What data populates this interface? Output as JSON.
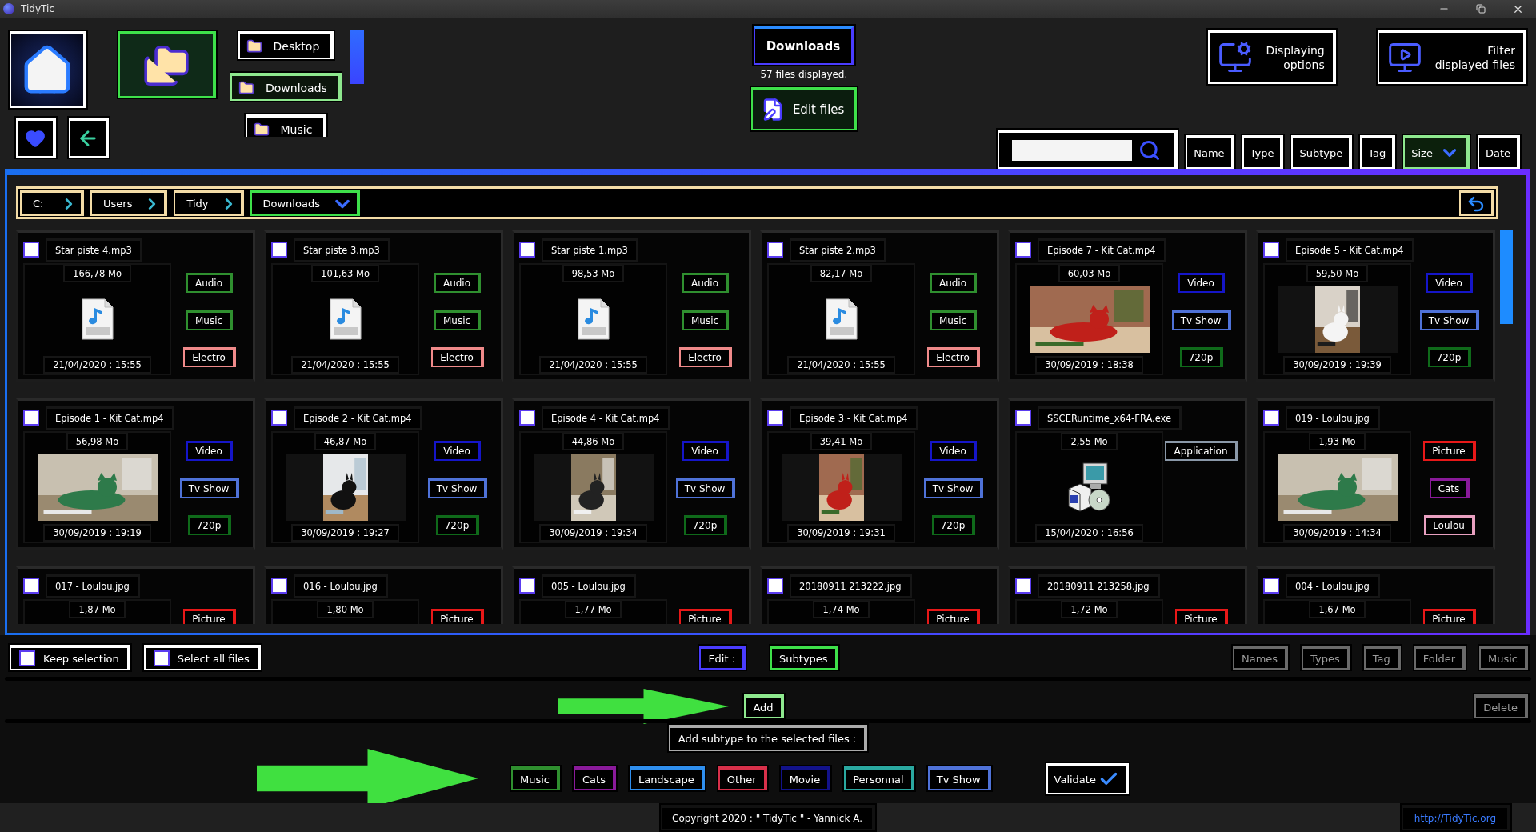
{
  "window": {
    "title": "TidyTic"
  },
  "nav": {
    "folders": [
      {
        "label": "Desktop",
        "selected": false
      },
      {
        "label": "Downloads",
        "selected": true
      },
      {
        "label": "Music",
        "selected": false
      }
    ]
  },
  "current": {
    "title": "Downloads",
    "count": "57 files displayed.",
    "edit_button": "Edit files"
  },
  "options": [
    {
      "kind": "display",
      "lines": [
        "Displaying",
        "options"
      ]
    },
    {
      "kind": "filter",
      "lines": [
        "Filter",
        "displayed files"
      ]
    }
  ],
  "sort_buttons": [
    {
      "label": "Name",
      "selected": false
    },
    {
      "label": "Type",
      "selected": false
    },
    {
      "label": "Subtype",
      "selected": false
    },
    {
      "label": "Tag",
      "selected": false
    },
    {
      "label": "Size",
      "selected": true
    },
    {
      "label": "Date",
      "selected": false
    }
  ],
  "breadcrumb": [
    {
      "label": "C:",
      "selected": false
    },
    {
      "label": "Users",
      "selected": false
    },
    {
      "label": "Tidy",
      "selected": false
    },
    {
      "label": "Downloads",
      "selected": true
    }
  ],
  "files": [
    {
      "name": "Star piste 4.mp3",
      "checked": false,
      "size": "166,78 Mo",
      "date": "21/04/2020 : 15:55",
      "kind": "audio",
      "tags": [
        {
          "label": "Audio",
          "color": "#2f8f2f"
        },
        {
          "label": "Music",
          "color": "#2f8f2f"
        },
        {
          "label": "Electro",
          "color": "#f08a8a"
        }
      ]
    },
    {
      "name": "Star piste 3.mp3",
      "checked": false,
      "size": "101,63 Mo",
      "date": "21/04/2020 : 15:55",
      "kind": "audio",
      "tags": [
        {
          "label": "Audio",
          "color": "#2f8f2f"
        },
        {
          "label": "Music",
          "color": "#2f8f2f"
        },
        {
          "label": "Electro",
          "color": "#f08a8a"
        }
      ]
    },
    {
      "name": "Star piste 1.mp3",
      "checked": false,
      "size": "98,53 Mo",
      "date": "21/04/2020 : 15:55",
      "kind": "audio",
      "tags": [
        {
          "label": "Audio",
          "color": "#2f8f2f"
        },
        {
          "label": "Music",
          "color": "#2f8f2f"
        },
        {
          "label": "Electro",
          "color": "#f08a8a"
        }
      ]
    },
    {
      "name": "Star piste 2.mp3",
      "checked": false,
      "size": "82,17 Mo",
      "date": "21/04/2020 : 15:55",
      "kind": "audio",
      "tags": [
        {
          "label": "Audio",
          "color": "#2f8f2f"
        },
        {
          "label": "Music",
          "color": "#2f8f2f"
        },
        {
          "label": "Electro",
          "color": "#f08a8a"
        }
      ]
    },
    {
      "name": "Episode 7 - Kit Cat.mp4",
      "checked": false,
      "size": "60,03 Mo",
      "date": "30/09/2019 : 18:38",
      "kind": "picture",
      "portrait": false,
      "tags": [
        {
          "label": "Video",
          "color": "#1515c8"
        },
        {
          "label": "Tv Show",
          "color": "#4f72d8"
        },
        {
          "label": "720p",
          "color": "#0f6a1a"
        }
      ]
    },
    {
      "name": "Episode 5 - Kit Cat.mp4",
      "checked": false,
      "size": "59,50 Mo",
      "date": "30/09/2019 : 19:39",
      "kind": "picture",
      "portrait": true,
      "tags": [
        {
          "label": "Video",
          "color": "#1515c8"
        },
        {
          "label": "Tv Show",
          "color": "#4f72d8"
        },
        {
          "label": "720p",
          "color": "#0f6a1a"
        }
      ]
    },
    {
      "name": "Episode 1 - Kit Cat.mp4",
      "checked": false,
      "size": "56,98 Mo",
      "date": "30/09/2019 : 19:19",
      "kind": "picture",
      "portrait": false,
      "tags": [
        {
          "label": "Video",
          "color": "#1515c8"
        },
        {
          "label": "Tv Show",
          "color": "#4f72d8"
        },
        {
          "label": "720p",
          "color": "#0f6a1a"
        }
      ]
    },
    {
      "name": "Episode 2 - Kit Cat.mp4",
      "checked": false,
      "size": "46,87 Mo",
      "date": "30/09/2019 : 19:27",
      "kind": "picture",
      "portrait": true,
      "tags": [
        {
          "label": "Video",
          "color": "#1515c8"
        },
        {
          "label": "Tv Show",
          "color": "#4f72d8"
        },
        {
          "label": "720p",
          "color": "#0f6a1a"
        }
      ]
    },
    {
      "name": "Episode 4 - Kit Cat.mp4",
      "checked": false,
      "size": "44,86 Mo",
      "date": "30/09/2019 : 19:34",
      "kind": "picture",
      "portrait": true,
      "tags": [
        {
          "label": "Video",
          "color": "#1515c8"
        },
        {
          "label": "Tv Show",
          "color": "#4f72d8"
        },
        {
          "label": "720p",
          "color": "#0f6a1a"
        }
      ]
    },
    {
      "name": "Episode 3 - Kit Cat.mp4",
      "checked": false,
      "size": "39,41 Mo",
      "date": "30/09/2019 : 19:31",
      "kind": "picture",
      "portrait": true,
      "tags": [
        {
          "label": "Video",
          "color": "#1515c8"
        },
        {
          "label": "Tv Show",
          "color": "#4f72d8"
        },
        {
          "label": "720p",
          "color": "#0f6a1a"
        }
      ]
    },
    {
      "name": "SSCERuntime_x64-FRA.exe",
      "checked": false,
      "size": "2,55 Mo",
      "date": "15/04/2020 : 16:56",
      "kind": "installer",
      "tags": [
        {
          "label": "Application",
          "color": "#8a98a8"
        }
      ]
    },
    {
      "name": "019 - Loulou.jpg",
      "checked": false,
      "size": "1,93 Mo",
      "date": "30/09/2019 : 14:34",
      "kind": "picture",
      "portrait": false,
      "tags": [
        {
          "label": "Picture",
          "color": "#e81818"
        },
        {
          "label": "Cats",
          "color": "#8a1a9a"
        },
        {
          "label": "Loulou",
          "color": "#e8a0c0"
        }
      ]
    },
    {
      "name": "017 - Loulou.jpg",
      "checked": false,
      "size": "1,87 Mo",
      "tags": [
        {
          "label": "Picture",
          "color": "#e81818"
        }
      ]
    },
    {
      "name": "016 - Loulou.jpg",
      "checked": false,
      "size": "1,80 Mo",
      "tags": [
        {
          "label": "Picture",
          "color": "#e81818"
        }
      ]
    },
    {
      "name": "005 - Loulou.jpg",
      "checked": false,
      "size": "1,77 Mo",
      "tags": [
        {
          "label": "Picture",
          "color": "#e81818"
        }
      ]
    },
    {
      "name": "20180911 213222.jpg",
      "checked": false,
      "size": "1,74 Mo",
      "tags": [
        {
          "label": "Picture",
          "color": "#e81818"
        }
      ]
    },
    {
      "name": "20180911 213258.jpg",
      "checked": false,
      "size": "1,72 Mo",
      "tags": [
        {
          "label": "Picture",
          "color": "#e81818"
        }
      ]
    },
    {
      "name": "004 - Loulou.jpg",
      "checked": false,
      "size": "1,67 Mo",
      "tags": [
        {
          "label": "Picture",
          "color": "#e81818"
        }
      ]
    }
  ],
  "selection": [
    {
      "label": "Keep selection",
      "checked": false
    },
    {
      "label": "Select all files",
      "checked": false
    }
  ],
  "edit": {
    "label": "Edit :",
    "mode": {
      "label": "Subtypes",
      "selected": true
    },
    "fields": [
      {
        "label": "Names",
        "disabled": true
      },
      {
        "label": "Types",
        "disabled": true
      },
      {
        "label": "Tag",
        "disabled": true
      },
      {
        "label": "Folder",
        "disabled": true
      },
      {
        "label": "Music",
        "disabled": true
      }
    ]
  },
  "actions": [
    {
      "label": "Add",
      "disabled": false
    },
    {
      "label": "Delete",
      "disabled": true
    }
  ],
  "subtype_prompt": "Add subtype to the selected files :",
  "subtypes": [
    {
      "label": "Music",
      "color": "#2f8f2f"
    },
    {
      "label": "Cats",
      "color": "#8a1a9a"
    },
    {
      "label": "Landscape",
      "color": "#2f8fef"
    },
    {
      "label": "Other",
      "color": "#d8304a"
    },
    {
      "label": "Movie",
      "color": "#12128a"
    },
    {
      "label": "Personnal",
      "color": "#2aa8a0"
    },
    {
      "label": "Tv Show",
      "color": "#4f72d8"
    }
  ],
  "validate": "Validate",
  "footer": {
    "copyright": "Copyright 2020 : \" TidyTic \" - Yannick A.",
    "link": "http://TidyTic.org"
  }
}
